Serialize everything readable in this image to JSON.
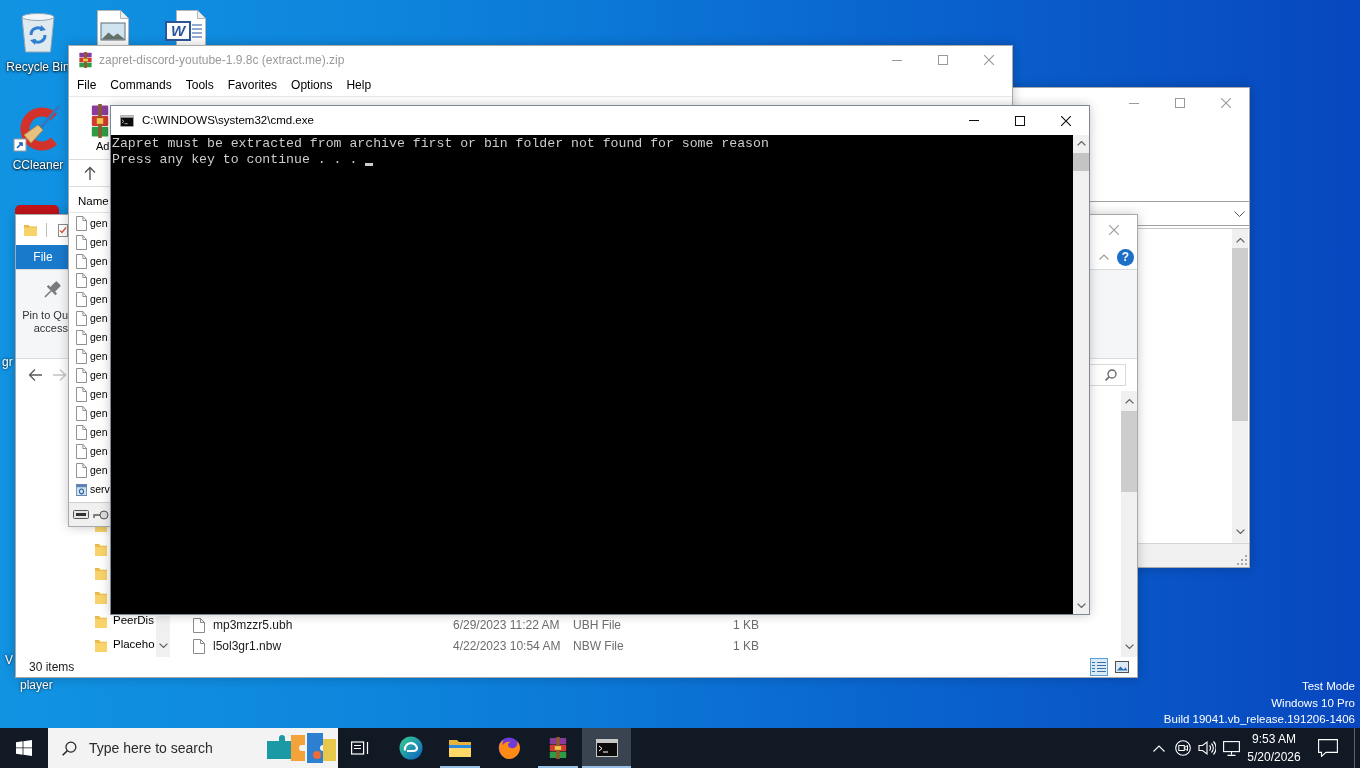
{
  "desktop": {
    "icons": [
      {
        "kind": "recycle-bin",
        "label": "Recycle Bin"
      },
      {
        "kind": "image-file"
      },
      {
        "kind": "word-document",
        "logo_letter": "W"
      },
      {
        "kind": "ccleaner",
        "label": "CCleaner",
        "shortcut": true
      },
      {
        "kind": "covered-app"
      }
    ],
    "covered_labels": [
      "gr",
      "V",
      "player"
    ],
    "system_text": [
      "Test Mode",
      "Windows 10 Pro",
      "Build 19041.vb_release.191206-1406"
    ]
  },
  "winrar": {
    "title": "zapret-discord-youtube-1.9.8c (extract.me).zip",
    "active": false,
    "menu": [
      "File",
      "Commands",
      "Tools",
      "Favorites",
      "Options",
      "Help"
    ],
    "toolbar": [
      {
        "kind": "add",
        "label": "Ad"
      }
    ],
    "columns": [
      "Name"
    ],
    "rows": [
      {
        "name": "gen",
        "kind": "file"
      },
      {
        "name": "gen",
        "kind": "file"
      },
      {
        "name": "gen",
        "kind": "file"
      },
      {
        "name": "gen",
        "kind": "file"
      },
      {
        "name": "gen",
        "kind": "file"
      },
      {
        "name": "gen",
        "kind": "file"
      },
      {
        "name": "gen",
        "kind": "file"
      },
      {
        "name": "gen",
        "kind": "file"
      },
      {
        "name": "gen",
        "kind": "file"
      },
      {
        "name": "gen",
        "kind": "file"
      },
      {
        "name": "gen",
        "kind": "file"
      },
      {
        "name": "gen",
        "kind": "file"
      },
      {
        "name": "gen",
        "kind": "file"
      },
      {
        "name": "gen",
        "kind": "file"
      },
      {
        "name": "serv",
        "kind": "config"
      }
    ]
  },
  "cmd": {
    "title": "C:\\WINDOWS\\system32\\cmd.exe",
    "active": true,
    "lines": [
      "Zapret must be extracted from archive first or bin folder not found for some reason",
      "Press any key to continue . . ."
    ],
    "cursor": true
  },
  "back_window": {
    "active": false
  },
  "explorer": {
    "active": false,
    "file_tab": "File",
    "help_label": "?",
    "ribbon_buttons": [
      {
        "kind": "pin",
        "lines": [
          "Pin to Qu",
          "access"
        ]
      }
    ],
    "nav_buttons": [
      {
        "kind": "back",
        "disabled": false
      },
      {
        "kind": "forward",
        "disabled": true
      }
    ],
    "nav_items": [
      {
        "kind": "folder"
      },
      {
        "kind": "folder"
      },
      {
        "kind": "folder"
      },
      {
        "kind": "folder"
      },
      {
        "kind": "folder",
        "label": "PeerDis"
      },
      {
        "kind": "folder",
        "label": "Placeho"
      }
    ],
    "files": [
      {
        "name": "mp3mzzr5.ubh",
        "date": "6/29/2023 11:22 AM",
        "type": "UBH File",
        "size": "1 KB"
      },
      {
        "name": "l5ol3gr1.nbw",
        "date": "4/22/2023 10:54 AM",
        "type": "NBW File",
        "size": "1 KB"
      }
    ],
    "status": "30 items",
    "views": [
      {
        "kind": "details",
        "selected": true
      },
      {
        "kind": "large-icons",
        "selected": false
      }
    ]
  },
  "taskbar": {
    "search_placeholder": "Type here to search",
    "buttons": [
      {
        "kind": "task-view",
        "selected": false,
        "running": false
      },
      {
        "kind": "edge",
        "selected": false,
        "running": false
      },
      {
        "kind": "file-explorer",
        "selected": false,
        "running": true
      },
      {
        "kind": "firefox",
        "selected": false,
        "running": false
      },
      {
        "kind": "winrar",
        "selected": false,
        "running": true
      },
      {
        "kind": "cmd",
        "selected": true,
        "running": true
      }
    ],
    "clock": {
      "time": "9:53 AM",
      "date": "5/20/2026"
    }
  }
}
